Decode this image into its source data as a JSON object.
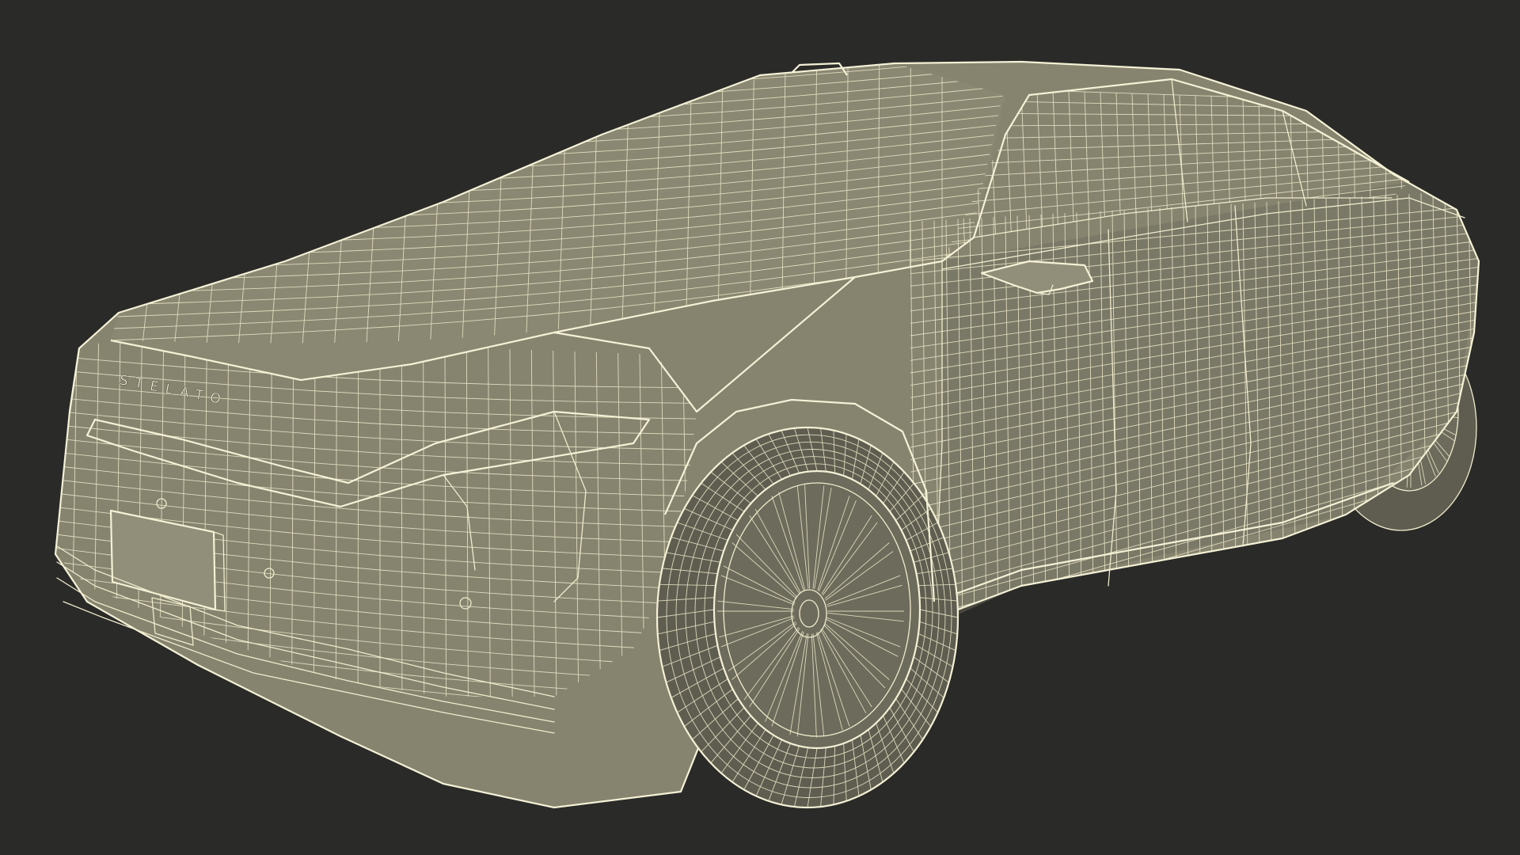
{
  "render": {
    "background_color": "#2a2a28",
    "surface_color": "#86836f",
    "wireframe_color": "#efeccd"
  },
  "vehicle": {
    "emblem_text": "STELATO"
  }
}
